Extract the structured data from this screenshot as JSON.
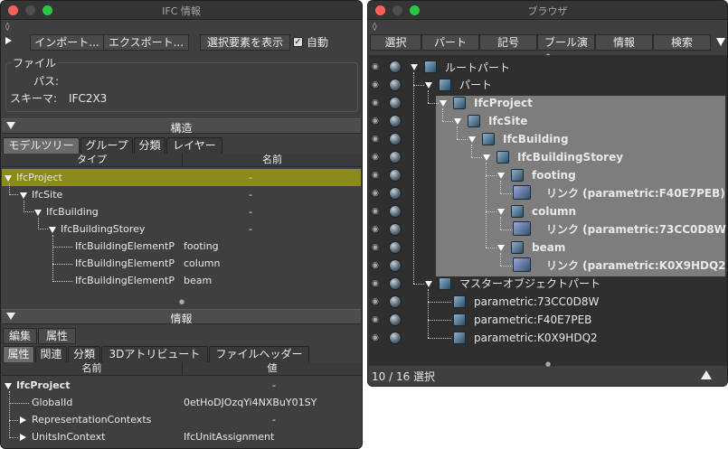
{
  "left_window": {
    "title": "IFC 情報",
    "toolbar": {
      "import_label": "インポート...",
      "export_label": "エクスポート...",
      "show_selected_label": "選択要素を表示",
      "auto_label": "自動"
    },
    "file": {
      "group_title": "ファイル",
      "path_label": "パス:",
      "path_value": "",
      "schema_label": "スキーマ:",
      "schema_value": "IFC2X3"
    },
    "structure": {
      "section_title": "構造",
      "tabs": [
        "モデルツリー",
        "グループ",
        "分類",
        "レイヤー"
      ],
      "columns": [
        "タイプ",
        "名前"
      ],
      "rows": [
        {
          "type": "IfcProject",
          "name": "-"
        },
        {
          "type": "IfcSite",
          "name": "-"
        },
        {
          "type": "IfcBuilding",
          "name": "-"
        },
        {
          "type": "IfcBuildingStorey",
          "name": "-"
        },
        {
          "type": "IfcBuildingElementP",
          "name": "footing"
        },
        {
          "type": "IfcBuildingElementP",
          "name": "column"
        },
        {
          "type": "IfcBuildingElementP",
          "name": "beam"
        }
      ]
    },
    "info": {
      "section_title": "情報",
      "edit_buttons": [
        "編集",
        "属性"
      ],
      "tabs": [
        "属性",
        "関連",
        "分類",
        "3Dアトリビュート",
        "ファイルヘッダー"
      ],
      "columns": [
        "名前",
        "値"
      ],
      "rows": [
        {
          "name": "IfcProject",
          "value": "-"
        },
        {
          "name": "GlobalId",
          "value": "0etHoDJOzqYi4NXBuY01SY"
        },
        {
          "name": "RepresentationContexts",
          "value": "-"
        },
        {
          "name": "UnitsInContext",
          "value": "IfcUnitAssignment"
        }
      ]
    }
  },
  "right_window": {
    "title": "ブラウザ",
    "tabs": [
      "選択",
      "パート",
      "記号",
      "ブール演",
      "情報",
      "検索"
    ],
    "tree": [
      {
        "label": "ルートパート"
      },
      {
        "label": "パート"
      },
      {
        "label": "IfcProject"
      },
      {
        "label": "IfcSite"
      },
      {
        "label": "IfcBuilding"
      },
      {
        "label": "IfcBuildingStorey"
      },
      {
        "label": "footing"
      },
      {
        "label": "リンク (parametric:F40E7PEB)"
      },
      {
        "label": "column"
      },
      {
        "label": "リンク (parametric:73CC0D8W)"
      },
      {
        "label": "beam"
      },
      {
        "label": "リンク (parametric:K0X9HDQ2)"
      },
      {
        "label": "マスターオブジェクトパート"
      },
      {
        "label": "parametric:73CC0D8W"
      },
      {
        "label": "parametric:F40E7PEB"
      },
      {
        "label": "parametric:K0X9HDQ2"
      }
    ],
    "status": "10 / 16 選択"
  },
  "colors": {
    "selected_row": "#8a8a1d",
    "highlight": "#7d7d7d",
    "window_bg": "#3f3f3f"
  }
}
